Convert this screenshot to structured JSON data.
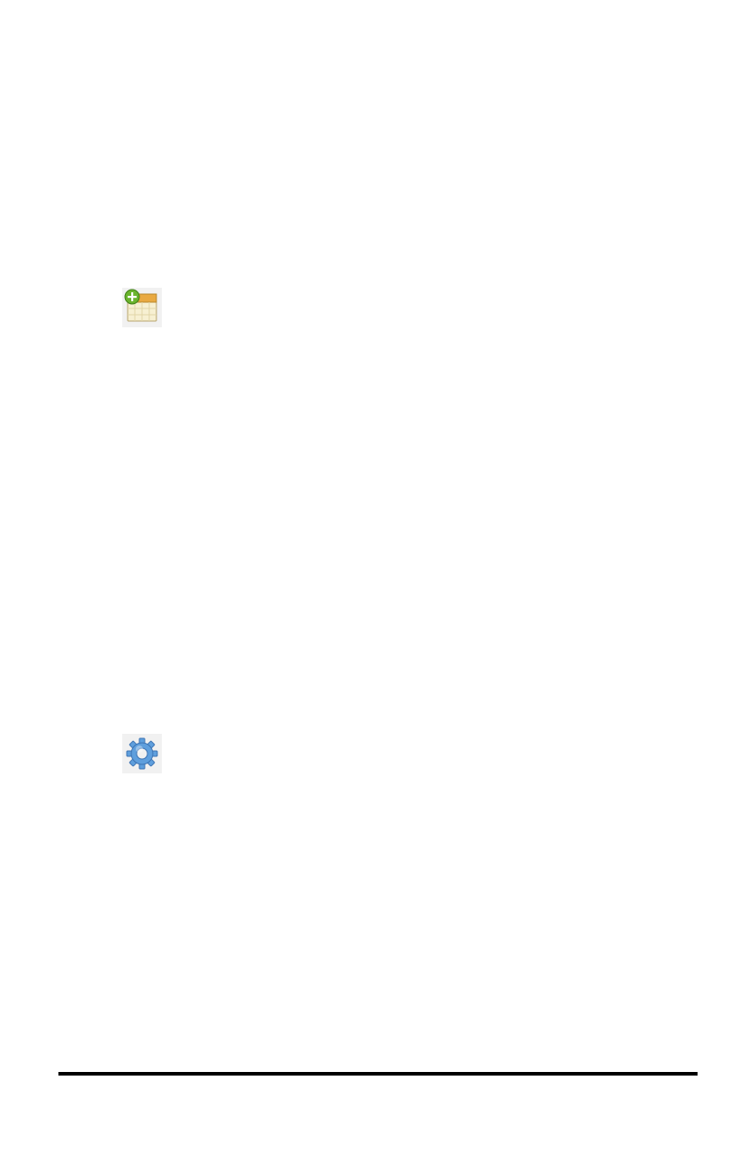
{
  "page": {
    "icons": [
      {
        "name": "new-calendar-icon"
      },
      {
        "name": "settings-gear-icon"
      }
    ],
    "colors": {
      "background": "#ffffff",
      "icon_tile": "#f1f1f1",
      "rule": "#000000",
      "calendar_header": "#e9a941",
      "calendar_body": "#f7f0d2",
      "add_badge": "#6ab42d",
      "gear": "#5f9fdd"
    }
  }
}
